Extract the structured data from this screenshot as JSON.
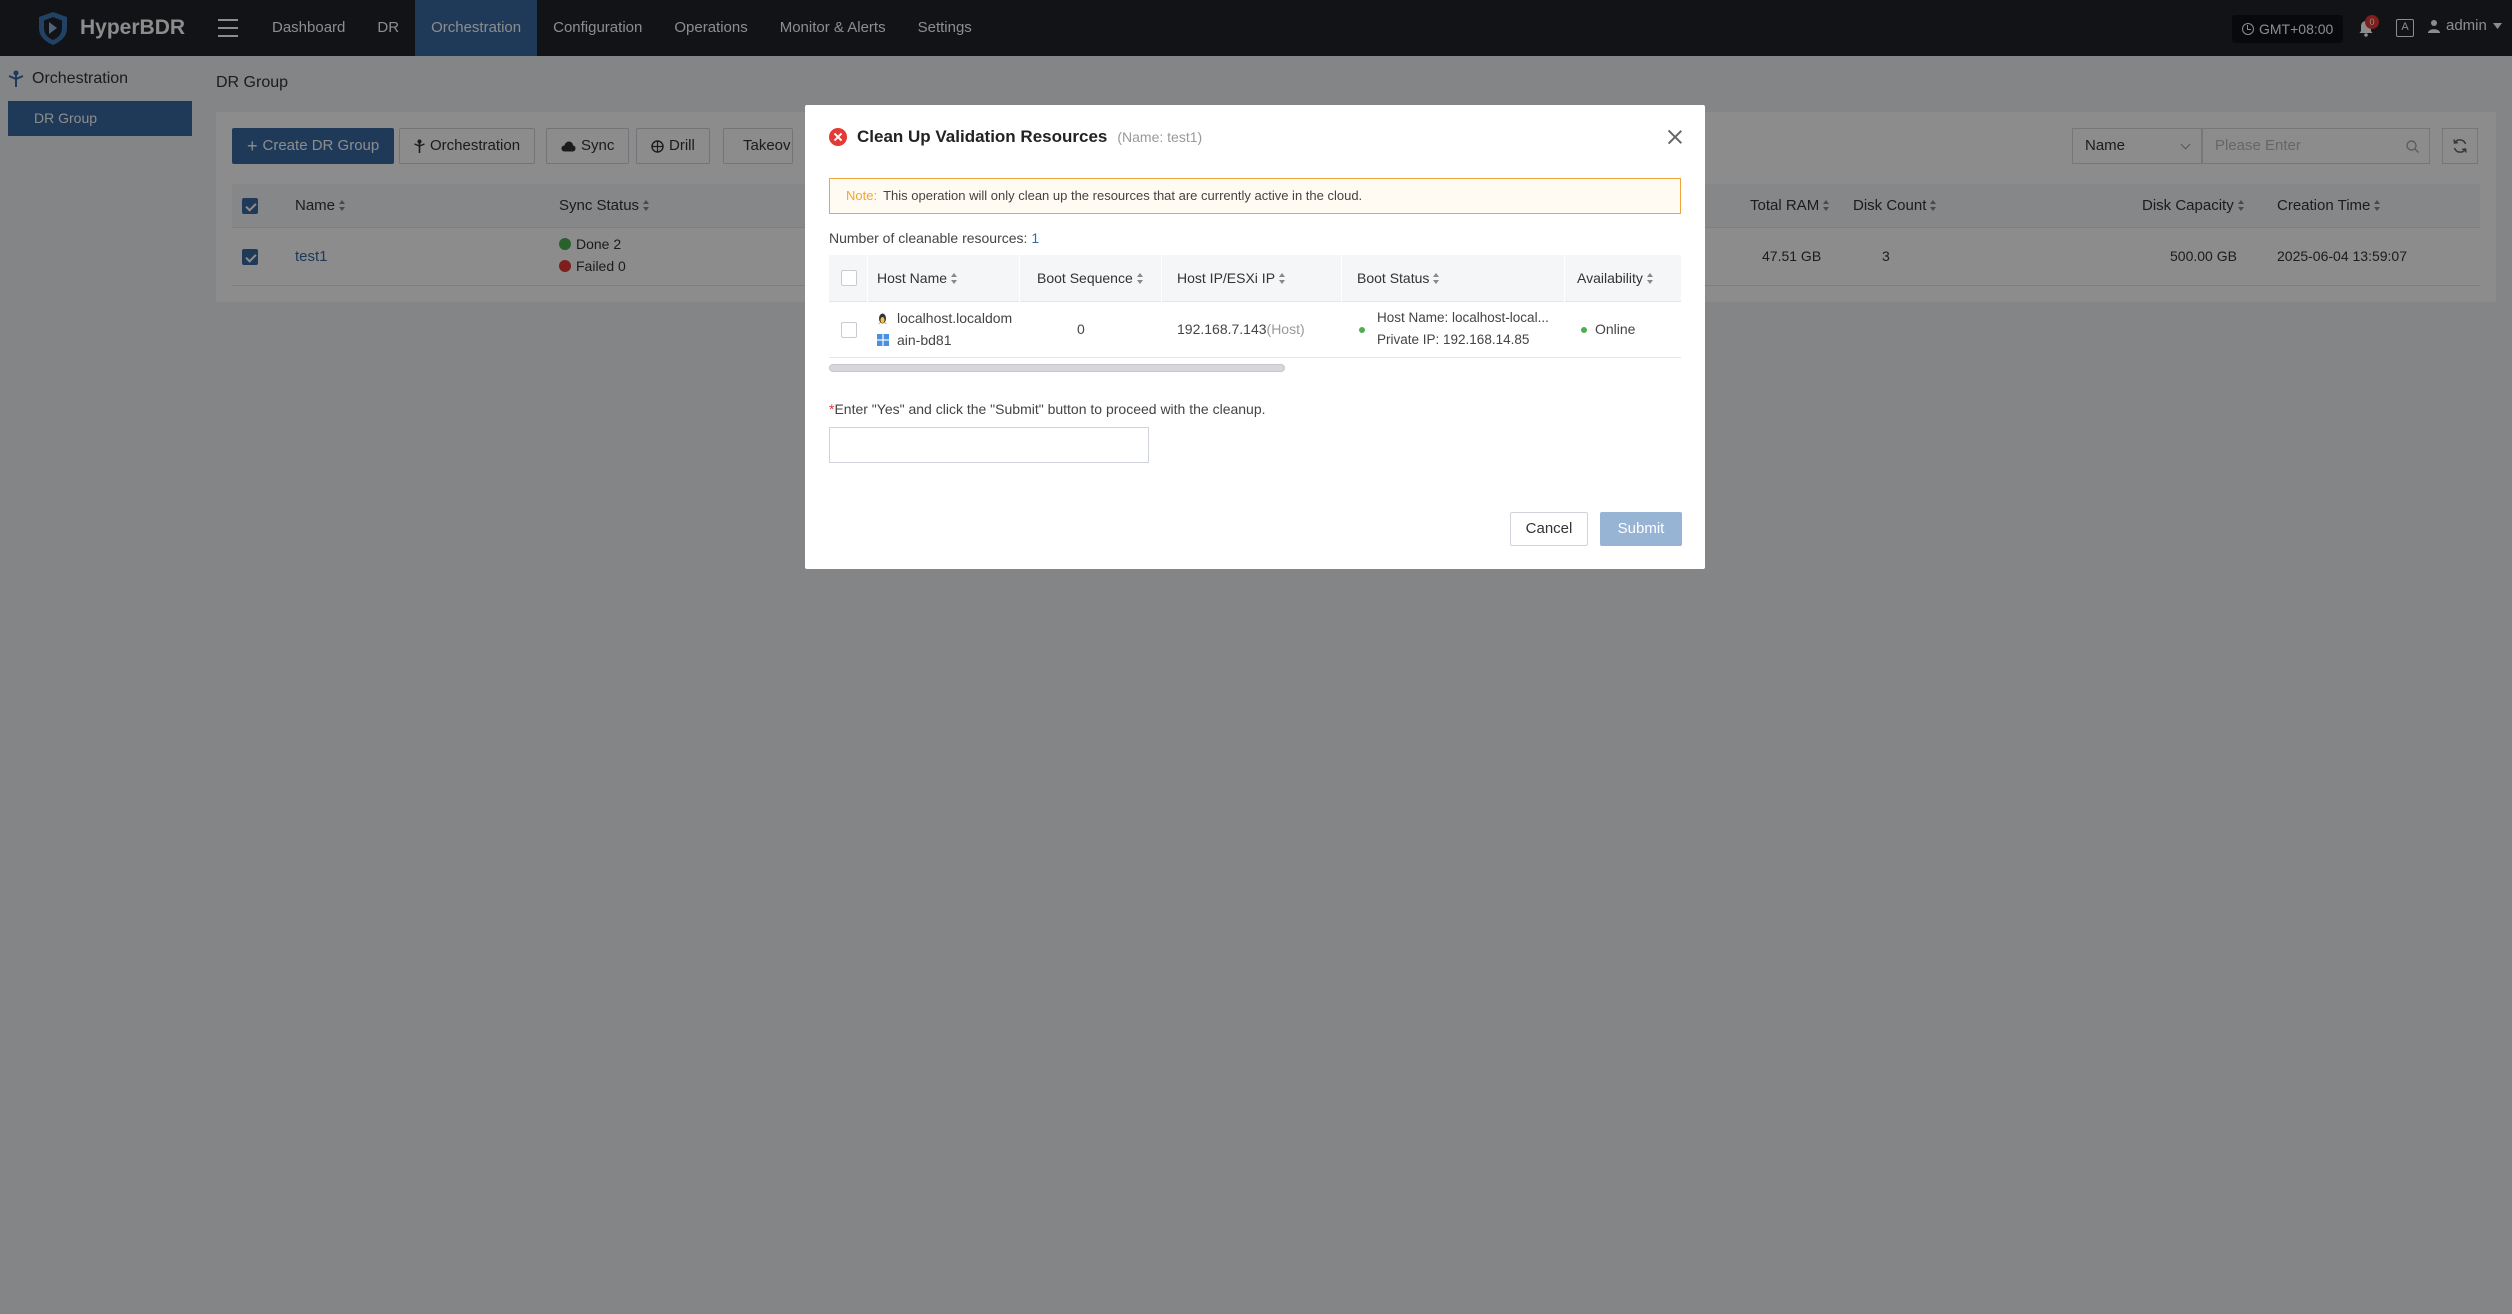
{
  "app": {
    "name": "HyperBDR",
    "timezone": "GMT+08:00",
    "notification_count": "0",
    "lang_icon_label": "A",
    "user": "admin"
  },
  "nav": {
    "items": [
      "Dashboard",
      "DR",
      "Orchestration",
      "Configuration",
      "Operations",
      "Monitor & Alerts",
      "Settings"
    ],
    "active": "Orchestration"
  },
  "sidebar": {
    "section": "Orchestration",
    "items": [
      {
        "label": "DR Group",
        "active": true
      }
    ]
  },
  "page": {
    "breadcrumb": "DR Group"
  },
  "toolbar": {
    "create": "Create DR Group",
    "orchestration": "Orchestration",
    "sync": "Sync",
    "drill": "Drill",
    "takeover": "Takeov"
  },
  "search": {
    "field": "Name",
    "placeholder": "Please Enter"
  },
  "table": {
    "columns": {
      "name": "Name",
      "sync_status": "Sync Status",
      "total_ram": "Total RAM",
      "disk_count": "Disk Count",
      "disk_capacity": "Disk Capacity",
      "creation_time": "Creation Time"
    },
    "rows": [
      {
        "name": "test1",
        "sync_done": "Done 2",
        "sync_failed": "Failed 0",
        "total_ram": "47.51 GB",
        "disk_count": "3",
        "disk_capacity": "500.00 GB",
        "creation_time": "2025-06-04 13:59:07"
      }
    ]
  },
  "dialog": {
    "title": "Clean Up Validation Resources",
    "subtitle": "(Name: test1)",
    "note_label": "Note:",
    "note_text": "This operation will only clean up the resources that are currently active in the cloud.",
    "count_label": "Number of cleanable resources:",
    "count_value": "1",
    "columns": {
      "host_name": "Host Name",
      "boot_sequence": "Boot Sequence",
      "host_ip": "Host IP/ESXi IP",
      "boot_status": "Boot Status",
      "availability": "Availability"
    },
    "rows": [
      {
        "host_name_line1": "localhost.localdom",
        "host_name_line2": "ain-bd81",
        "boot_sequence": "0",
        "host_ip": "192.168.7.143",
        "host_ip_tag": "(Host)",
        "boot_host_name": "Host Name: localhost-local...",
        "boot_private_ip": "Private IP: 192.168.14.85",
        "availability": "Online"
      }
    ],
    "prompt_required": "*",
    "prompt": "Enter \"Yes\" and click the \"Submit\" button to proceed with the cleanup.",
    "input_value": "",
    "cancel": "Cancel",
    "submit": "Submit"
  },
  "colors": {
    "topbar": "#1f2329",
    "accent": "#3a6aa3",
    "success": "#4caf50",
    "error": "#e53935",
    "warning": "#f0a53a",
    "submit_disabled": "#97b4d5"
  }
}
